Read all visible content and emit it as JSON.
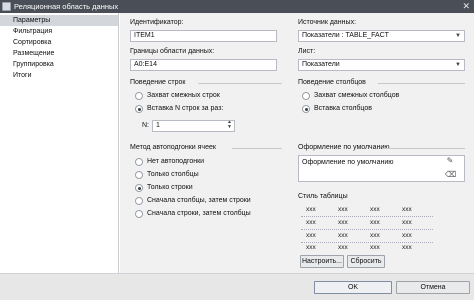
{
  "window": {
    "title": "Реляционная область данных",
    "close_glyph": "✕"
  },
  "nav": {
    "items": [
      {
        "label": "Параметры"
      },
      {
        "label": "Фильтрация"
      },
      {
        "label": "Сортировка"
      },
      {
        "label": "Размещение"
      },
      {
        "label": "Группировка"
      },
      {
        "label": "Итоги"
      }
    ],
    "active_index": 0
  },
  "identifier": {
    "label": "Идентификатор:",
    "value": "ITEM1"
  },
  "bounds": {
    "label": "Границы области данных:",
    "value": "A0:E14"
  },
  "source": {
    "label": "Источник данных:",
    "value": "Показатели : TABLE_FACT"
  },
  "sheet": {
    "label": "Лист:",
    "value": "Показатели"
  },
  "row_behavior": {
    "label": "Поведение строк",
    "options": [
      "Захват смежных строк",
      "Вставка N строк за раз:"
    ],
    "selected": 1,
    "n_label": "N:",
    "n_value": "1"
  },
  "col_behavior": {
    "label": "Поведение столбцов",
    "options": [
      "Захват смежных столбцов",
      "Вставка столбцов"
    ],
    "selected": 1
  },
  "autofit": {
    "label": "Метод автоподгонки ячеек",
    "options": [
      "Нет автоподгонки",
      "Только столбцы",
      "Только строки",
      "Сначала столбцы, затем строки",
      "Сначала строки, затем столбцы"
    ],
    "selected": 2
  },
  "formatting": {
    "label": "Оформление по умолчанию",
    "value": "Оформление по умолчанию",
    "edit_icon": "pencil-icon",
    "clear_icon": "eraser-icon"
  },
  "table_style": {
    "label": "Стиль таблицы",
    "cell": "xxx",
    "rows": 5,
    "cols": 4,
    "configure_label": "Настроить...",
    "reset_label": "Сбросить"
  },
  "footer": {
    "ok_label": "OK",
    "cancel_label": "Отмена"
  }
}
